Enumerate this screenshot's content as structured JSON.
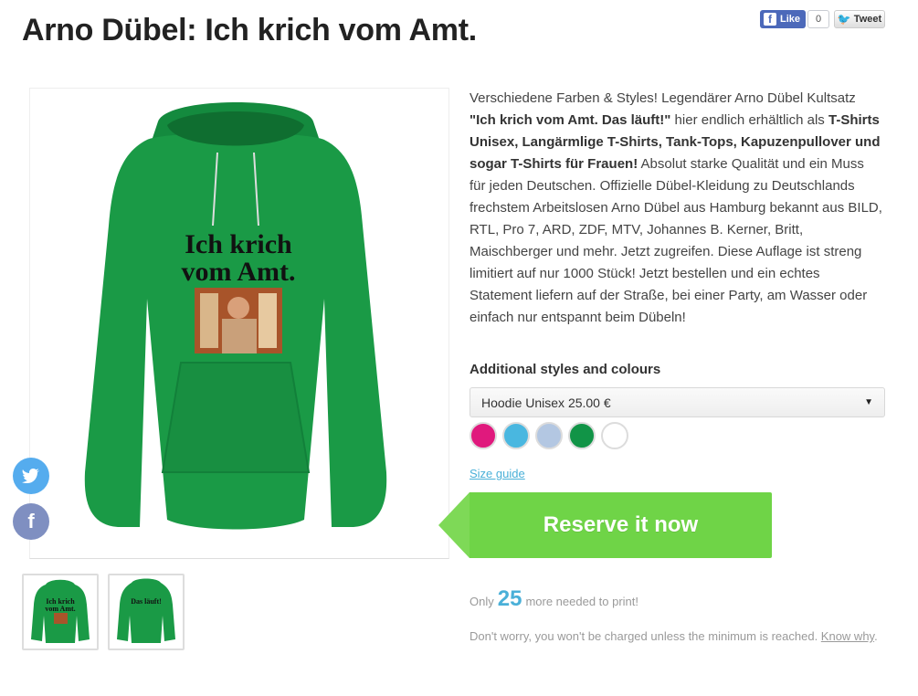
{
  "product": {
    "title": "Arno Dübel: Ich krich vom Amt.",
    "print_text_line1": "Ich krich",
    "print_text_line2": "vom Amt.",
    "back_print_text": "Das läuft!"
  },
  "social": {
    "like_label": "Like",
    "like_count": "0",
    "tweet_label": "Tweet",
    "share_icons": [
      "twitter-icon",
      "facebook-icon"
    ]
  },
  "description": {
    "p1": "Verschiedene Farben & Styles! Legendärer Arno Dübel Kultsatz ",
    "quote": "\"Ich krich vom Amt. Das läuft!\"",
    "p2": " hier endlich erhältlich als ",
    "styles_bold": "T-Shirts Unisex, Langärmlige T-Shirts, Tank-Tops, Kapuzenpullover und sogar T-Shirts für Frauen!",
    "p3": " Absolut starke Qualität und ein Muss für jeden Deutschen. Offizielle Dübel-Kleidung zu Deutschlands frechstem Arbeitslosen Arno Dübel aus Hamburg bekannt aus BILD, RTL, Pro 7, ARD, ZDF, MTV, Johannes B. Kerner, Britt, Maischberger und mehr. Jetzt zugreifen. Diese Auflage ist streng limitiert auf nur 1000 Stück! Jetzt bestellen und ein echtes Statement liefern auf der Straße, bei einer Party, am Wasser oder einfach nur entspannt beim Dübeln!"
  },
  "options": {
    "heading": "Additional styles and colours",
    "selected_style": "Hoodie Unisex 25.00 €",
    "colors": [
      "#e0197d",
      "#49b7e0",
      "#b3c7e2",
      "#119447",
      "#ffffff"
    ]
  },
  "size_guide_label": "Size guide",
  "cta": {
    "label": "Reserve it now",
    "color": "#6fd447"
  },
  "campaign": {
    "only": "Only",
    "count": "25",
    "needed_text": "more needed to print!",
    "note": "Don't worry, you won't be charged unless the minimum is reached. ",
    "know_why": "Know why",
    "period": "."
  },
  "colors": {
    "hoodie": "#1a9a46",
    "link": "#4ab0d8"
  }
}
